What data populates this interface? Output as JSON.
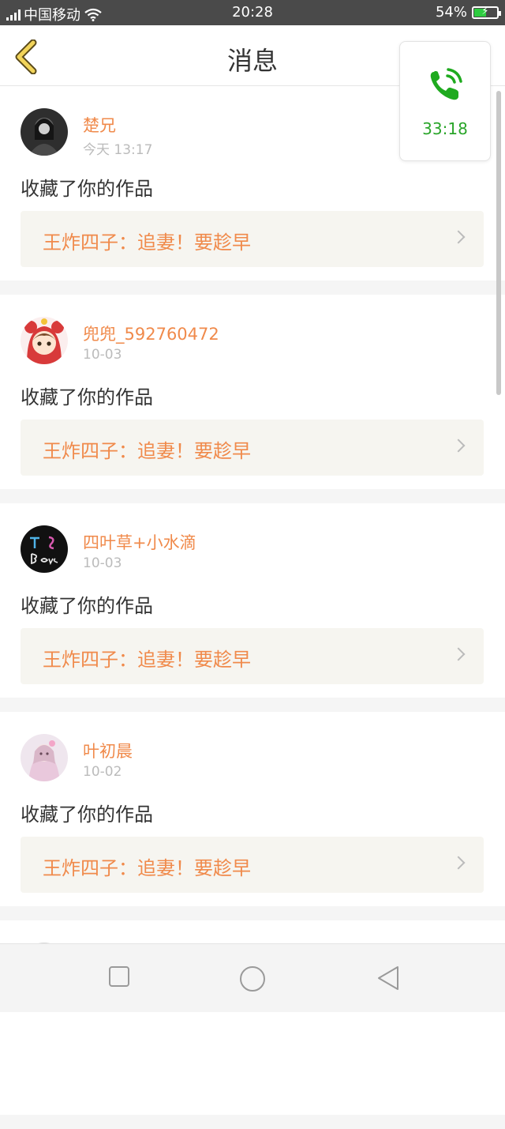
{
  "status_bar": {
    "carrier": "中国移动",
    "time": "20:28",
    "battery": "54%",
    "battery_level": 0.54
  },
  "header": {
    "title": "消息",
    "back_icon": "chevron-left-icon"
  },
  "call_widget": {
    "icon": "phone-ringing-icon",
    "duration": "33:18",
    "color": "#2aa52a"
  },
  "colors": {
    "accent": "#f08a4b",
    "work_bg": "#f6f5f0"
  },
  "messages": [
    {
      "user": "楚兄",
      "date": "今天 13:17",
      "action": "收藏了你的作品",
      "work_title": "王炸四子：追妻！要趁早"
    },
    {
      "user": "兜兜_592760472",
      "date": "10-03",
      "action": "收藏了你的作品",
      "work_title": "王炸四子：追妻！要趁早"
    },
    {
      "user": "四叶草+小水滴",
      "date": "10-03",
      "action": "收藏了你的作品",
      "work_title": "王炸四子：追妻！要趁早"
    },
    {
      "user": "叶初晨",
      "date": "10-02",
      "action": "收藏了你的作品",
      "work_title": "王炸四子：追妻！要趁早"
    }
  ],
  "nav_bar": {
    "buttons": [
      "square-icon",
      "circle-home-icon",
      "triangle-back-icon"
    ]
  }
}
